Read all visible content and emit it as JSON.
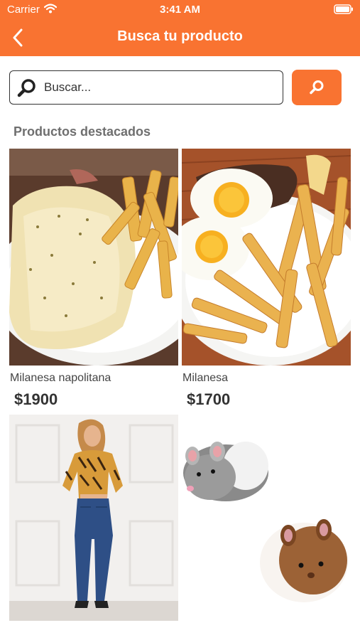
{
  "status_bar": {
    "carrier": "Carrier",
    "time": "3:41 AM"
  },
  "nav": {
    "title": "Busca tu producto",
    "back_icon": "chevron-left-icon"
  },
  "search": {
    "placeholder": "Buscar...",
    "value": "",
    "button_icon": "search-icon"
  },
  "section": {
    "title": "Productos destacados"
  },
  "products": [
    {
      "name": "Milanesa napolitana",
      "price": "$1900",
      "image": "milanesa-napolitana-photo"
    },
    {
      "name": "Milanesa",
      "price": "$1700",
      "image": "milanesa-con-huevos-photo"
    },
    {
      "name": "",
      "price": "",
      "image": "woman-tiger-print-top-jeans-photo"
    },
    {
      "name": "",
      "price": "",
      "image": "toy-hamsters-photo"
    }
  ],
  "colors": {
    "accent": "#f97331",
    "text": "#333333",
    "section_title": "#6f6f6f"
  }
}
